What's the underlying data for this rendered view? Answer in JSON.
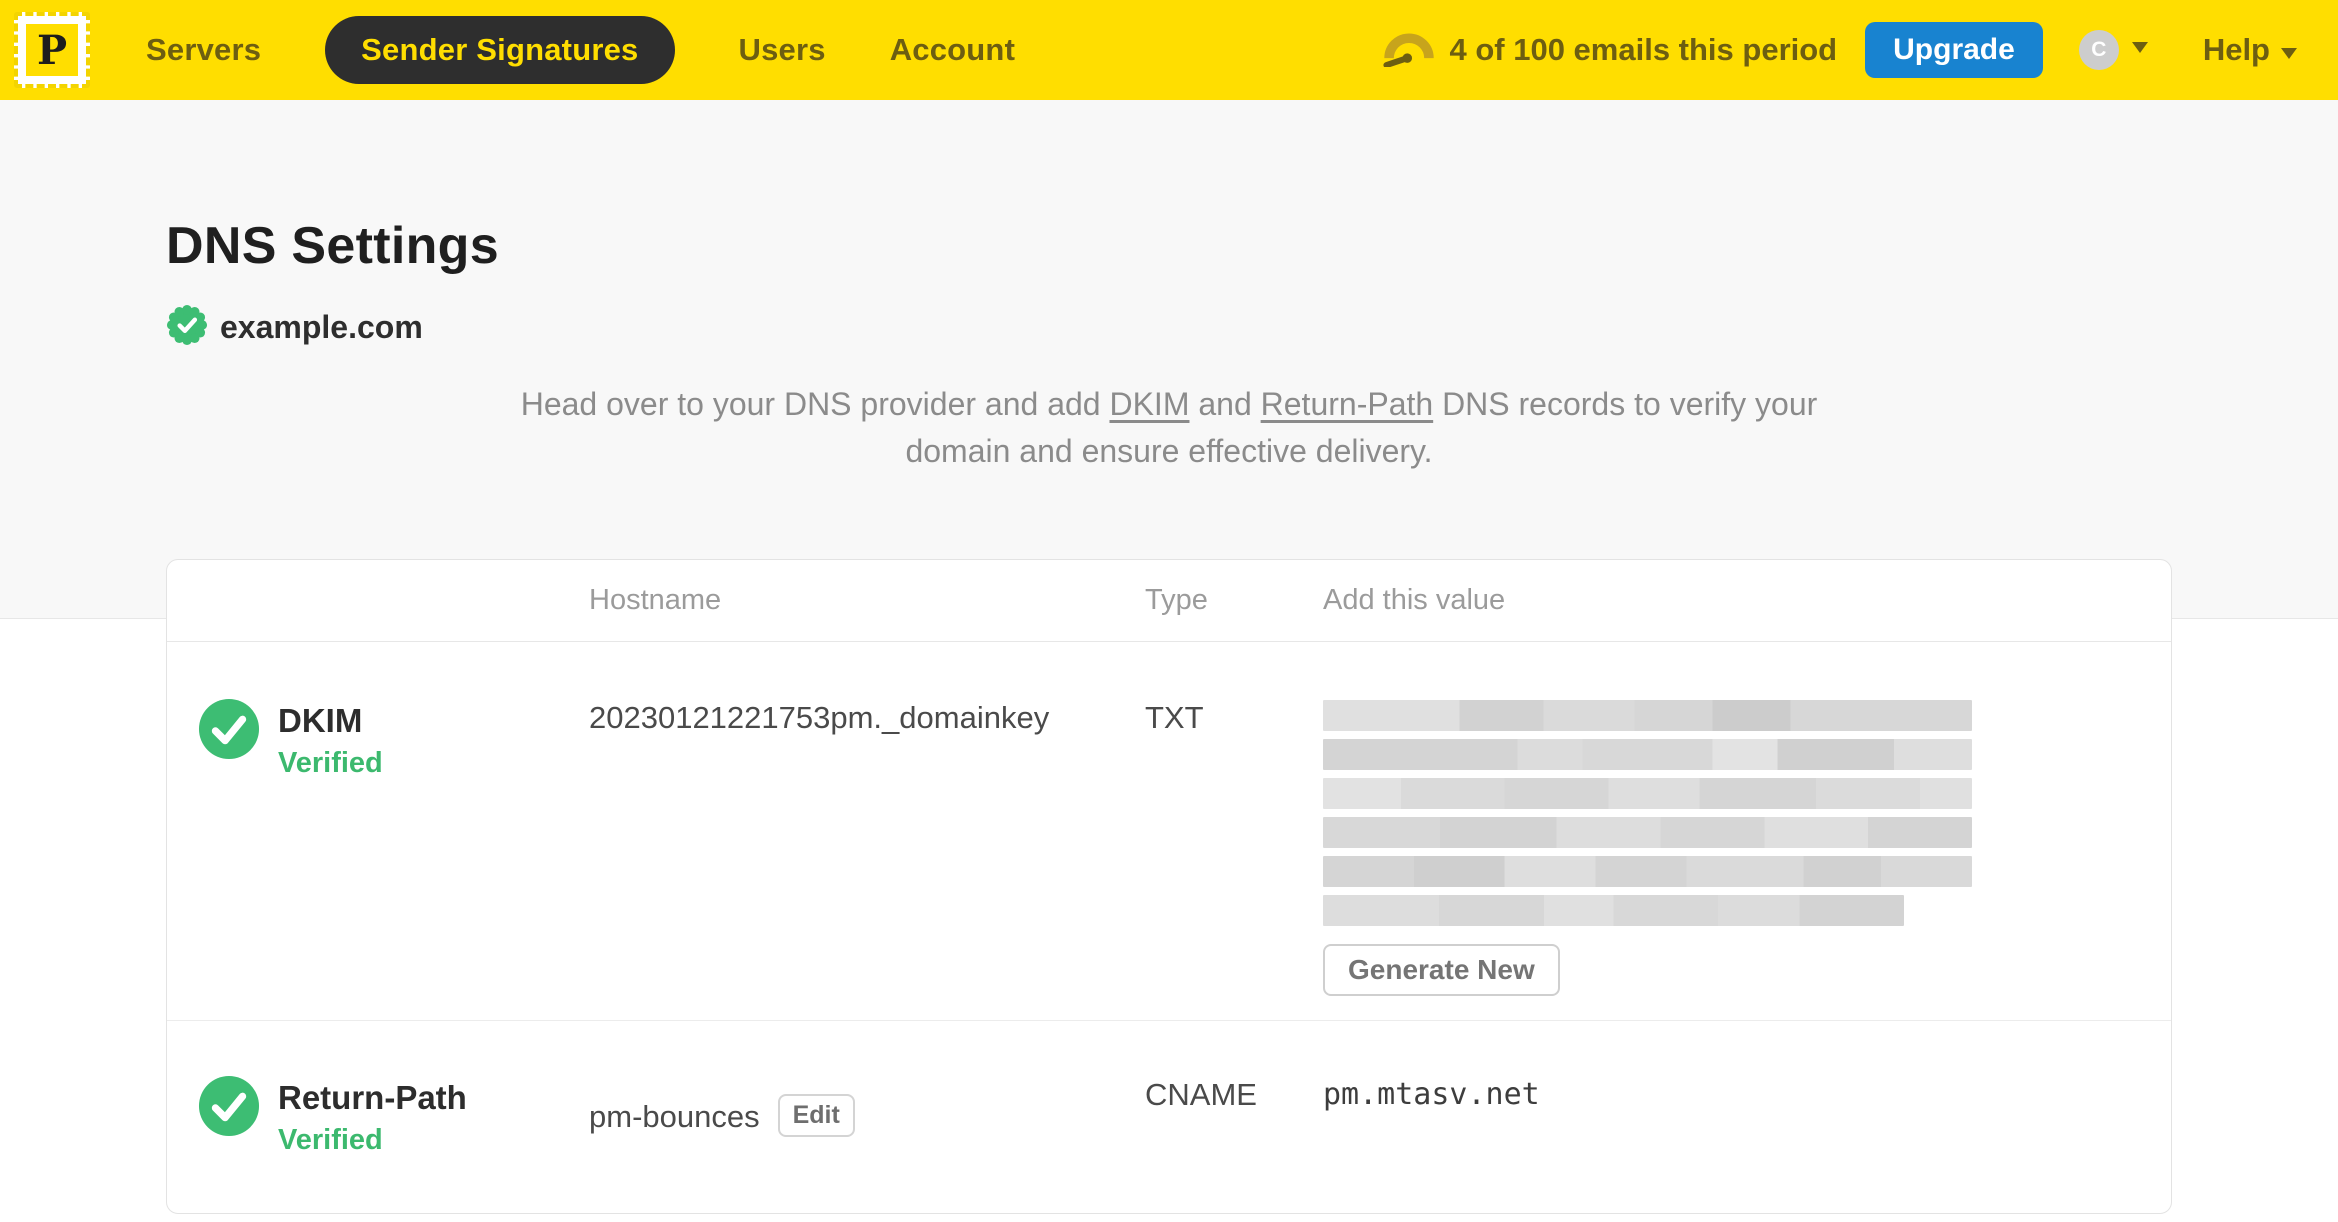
{
  "colors": {
    "brand_yellow": "#FFDE00",
    "nav_text_olive": "#6d5e11",
    "active_pill_bg": "#2e2e2e",
    "upgrade_blue": "#1883D0",
    "verified_green": "#3DBD73",
    "verified_text_green": "#3CB96E",
    "page_bg_top": "#F8F8F8"
  },
  "nav": {
    "logo_letter": "P",
    "items": [
      {
        "label": "Servers",
        "active": false
      },
      {
        "label": "Sender Signatures",
        "active": true
      },
      {
        "label": "Users",
        "active": false
      },
      {
        "label": "Account",
        "active": false
      }
    ],
    "usage": {
      "icon": "gauge-icon",
      "text": "4 of 100 emails this period"
    },
    "upgrade_label": "Upgrade",
    "avatar_initial": "C",
    "help_label": "Help"
  },
  "page": {
    "title": "DNS Settings",
    "domain": "example.com",
    "domain_badge": "verified-seal-icon",
    "intro": {
      "part1": "Head over to your DNS provider and add ",
      "link1": "DKIM",
      "part2": " and ",
      "link2": "Return-Path",
      "part3": " DNS records to verify your domain and ensure effective delivery."
    }
  },
  "table": {
    "headers": {
      "hostname": "Hostname",
      "type": "Type",
      "value": "Add this value"
    },
    "rows": [
      {
        "name": "DKIM",
        "status": "Verified",
        "hostname": "20230121221753pm._domainkey",
        "type": "TXT",
        "value_redacted": true,
        "redacted_line_widths_pct": [
          100,
          100,
          100,
          100,
          100,
          89.5
        ],
        "action_label": "Generate New"
      },
      {
        "name": "Return-Path",
        "status": "Verified",
        "hostname": "pm-bounces",
        "edit_label": "Edit",
        "type": "CNAME",
        "value": "pm.mtasv.net"
      }
    ]
  }
}
